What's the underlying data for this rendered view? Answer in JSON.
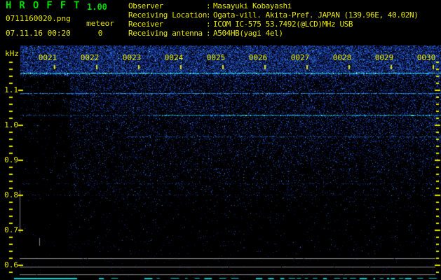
{
  "colors": {
    "background": "#000000",
    "text_yellow": "#e8e800",
    "text_green": "#00d800",
    "noise_blue": "#1830b4",
    "carrier_cyan": "#20c8e0",
    "grid_gray": "#989898"
  },
  "app": {
    "title": "HROFFT",
    "version": "1.00"
  },
  "capture": {
    "filename": "0711160020.png",
    "datetime": "07.11.16 00:20",
    "meteor_label": "meteor",
    "meteor_count": "0"
  },
  "station": {
    "rows": [
      {
        "label": "Observer",
        "separator": ":",
        "value": "Masayuki Kobayashi"
      },
      {
        "label": "Receiving Location",
        "separator": ":",
        "value": "Ogata-vill. Akita-Pref. JAPAN (139.96E, 40.02N)"
      },
      {
        "label": "Receiver",
        "separator": ":",
        "value": "ICOM IC-575 53.7492(@LCD)MHz USB"
      },
      {
        "label": "Receiving antenna",
        "separator": ":",
        "value": "A504HB(yagi 4el)"
      }
    ]
  },
  "chart_data": {
    "type": "heatmap",
    "description": "10-minute radio meteor observation FFT spectrogram: blue noise field with horizontal carrier lines, level graph strip at bottom",
    "x_axis": {
      "tick_labels": [
        "0021",
        "0022",
        "0023",
        "0024",
        "0025",
        "0026",
        "0027",
        "0028",
        "0029",
        "0030"
      ]
    },
    "y_axis": {
      "unit_label": "kHz",
      "tick_labels": [
        "1.1",
        "1.0",
        "0.9",
        "0.8",
        "0.7",
        "0.6"
      ],
      "range_khz": [
        0.56,
        1.23
      ]
    },
    "carrier_lines": [
      {
        "khz": 1.148,
        "strength": "strong"
      },
      {
        "khz": 1.09,
        "strength": "medium"
      },
      {
        "khz": 1.028,
        "strength": "medium",
        "note": "brighter after 0023"
      },
      {
        "khz": 0.966,
        "strength": "faint",
        "note": "starts near 0022.5"
      },
      {
        "khz": 0.832,
        "strength": "very-faint"
      },
      {
        "khz": 0.8,
        "strength": "very-faint"
      }
    ],
    "level_trace": {
      "color": "cyan",
      "position": "bottom-edge",
      "style": "solid then dashed"
    },
    "meteor_echo_count": 0
  }
}
